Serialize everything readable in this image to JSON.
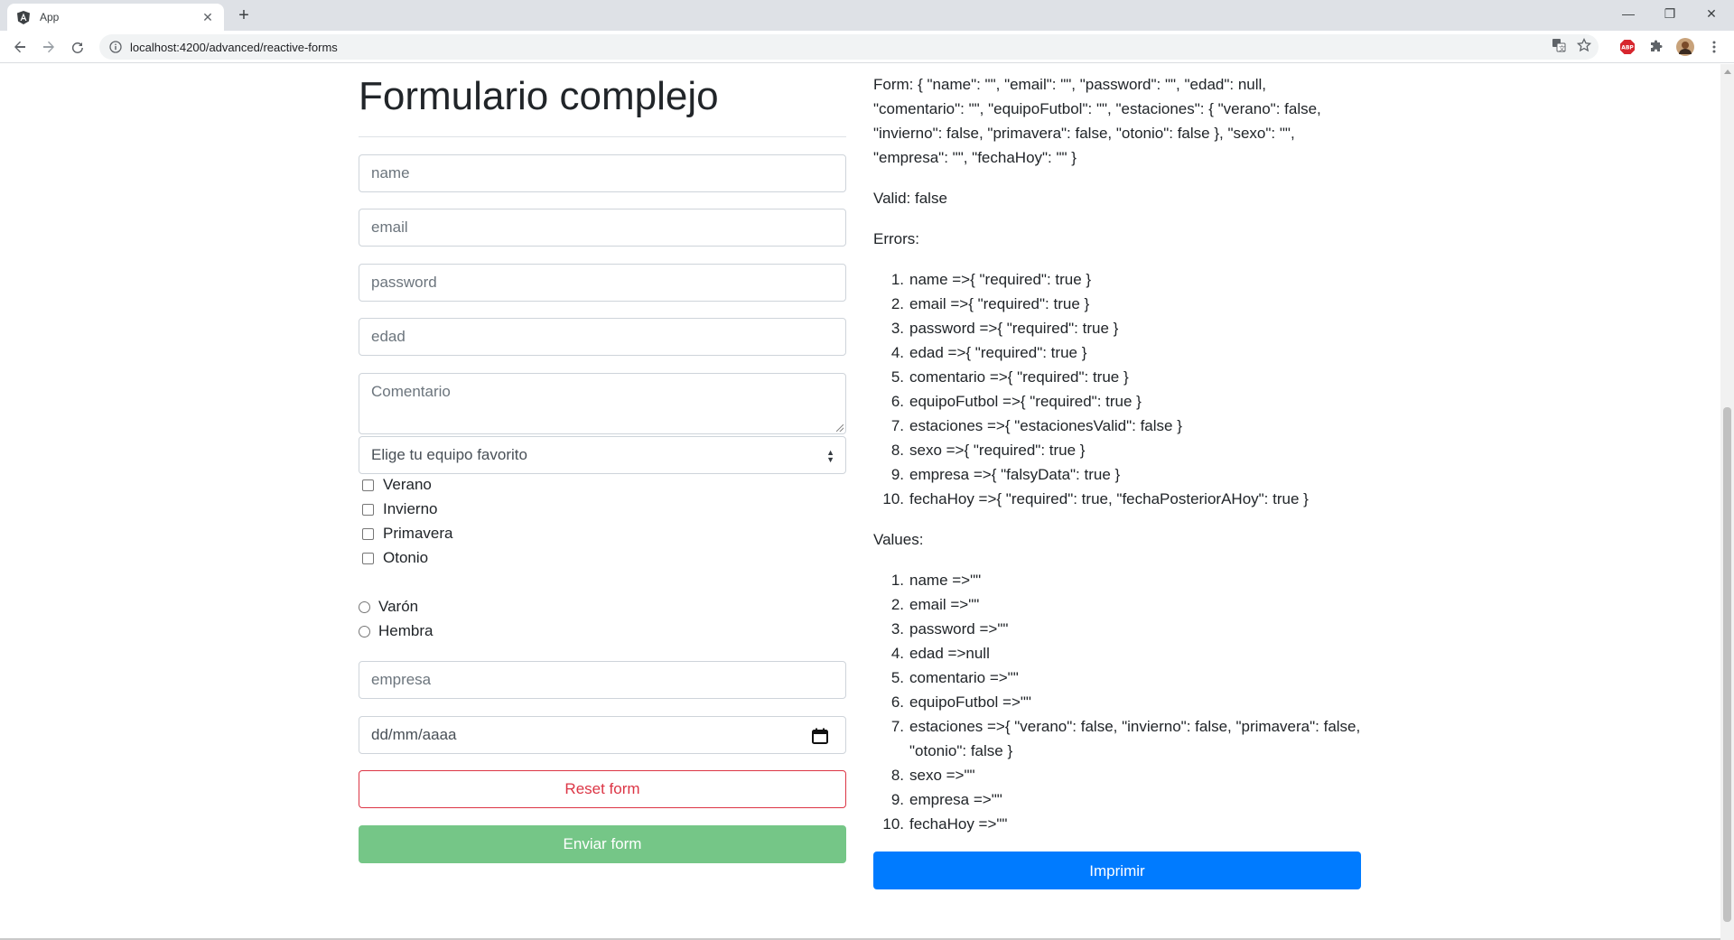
{
  "browser": {
    "tab_title": "App",
    "tab_close": "✕",
    "new_tab": "+",
    "url": "localhost:4200/advanced/reactive-forms",
    "window_controls": [
      "—",
      "❐",
      "✕"
    ],
    "ext_abp_label": "ABP"
  },
  "left": {
    "title": "Formulario complejo",
    "name_placeholder": "name",
    "email_placeholder": "email",
    "password_placeholder": "password",
    "edad_placeholder": "edad",
    "comentario_placeholder": "Comentario",
    "select_value": "Elige tu equipo favorito",
    "checkboxes": [
      "Verano",
      "Invierno",
      "Primavera",
      "Otonio"
    ],
    "radios": [
      "Varón",
      "Hembra"
    ],
    "empresa_placeholder": "empresa",
    "date_placeholder": "dd/mm/aaaa",
    "reset_label": "Reset form",
    "submit_label": "Enviar form"
  },
  "right": {
    "form_json": "Form: { \"name\": \"\", \"email\": \"\", \"password\": \"\", \"edad\": null, \"comentario\": \"\", \"equipoFutbol\": \"\", \"estaciones\": { \"verano\": false, \"invierno\": false, \"primavera\": false, \"otonio\": false }, \"sexo\": \"\", \"empresa\": \"\", \"fechaHoy\": \"\" }",
    "valid_text": "Valid: false",
    "errors_heading": "Errors:",
    "errors": [
      "name =>{ \"required\": true }",
      "email =>{ \"required\": true }",
      "password =>{ \"required\": true }",
      "edad =>{ \"required\": true }",
      "comentario =>{ \"required\": true }",
      "equipoFutbol =>{ \"required\": true }",
      "estaciones =>{ \"estacionesValid\": false }",
      "sexo =>{ \"required\": true }",
      "empresa =>{ \"falsyData\": true }",
      "fechaHoy =>{ \"required\": true, \"fechaPosteriorAHoy\": true }"
    ],
    "values_heading": "Values:",
    "values": [
      "name =>\"\"",
      "email =>\"\"",
      "password =>\"\"",
      "edad =>null",
      "comentario =>\"\"",
      "equipoFutbol =>\"\"",
      "estaciones =>{ \"verano\": false, \"invierno\": false, \"primavera\": false, \"otonio\": false }",
      "sexo =>\"\"",
      "empresa =>\"\"",
      "fechaHoy =>\"\""
    ],
    "print_label": "Imprimir"
  },
  "colors": {
    "danger": "#dc3545",
    "success_disabled": "#75c687",
    "primary": "#007bff"
  }
}
